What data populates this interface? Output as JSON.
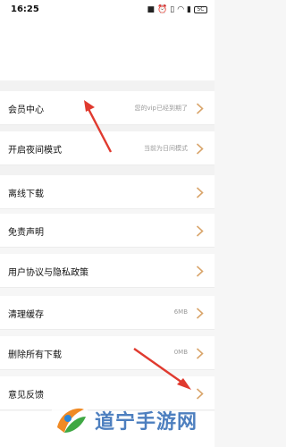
{
  "status_bar": {
    "time": "16:25",
    "battery": "5C",
    "icons": [
      "notification-icon",
      "alarm-icon",
      "vibrate-icon",
      "wifi-icon",
      "signal-icon",
      "battery-icon"
    ]
  },
  "settings": {
    "items": [
      {
        "label": "会员中心",
        "value": "您的vip已经到期了",
        "icon": "chevron-right-icon"
      },
      {
        "label": "开启夜间模式",
        "value": "当前为日间模式",
        "icon": "chevron-right-icon"
      },
      {
        "label": "离线下载",
        "value": "",
        "icon": "chevron-right-icon"
      },
      {
        "label": "免责声明",
        "value": "",
        "icon": "chevron-right-icon"
      },
      {
        "label": "用户协议与隐私政策",
        "value": "",
        "icon": "chevron-right-icon"
      },
      {
        "label": "清理缓存",
        "value": "6MB",
        "icon": "chevron-right-icon"
      },
      {
        "label": "删除所有下载",
        "value": "0MB",
        "icon": "chevron-right-icon"
      },
      {
        "label": "意见反馈",
        "value": "",
        "icon": "chevron-right-icon"
      }
    ]
  },
  "watermark": {
    "text": "道宁手游网"
  },
  "colors": {
    "chevron": "#d9a56b",
    "arrow": "#e03a2f",
    "watermark": "#4d7fbf"
  }
}
